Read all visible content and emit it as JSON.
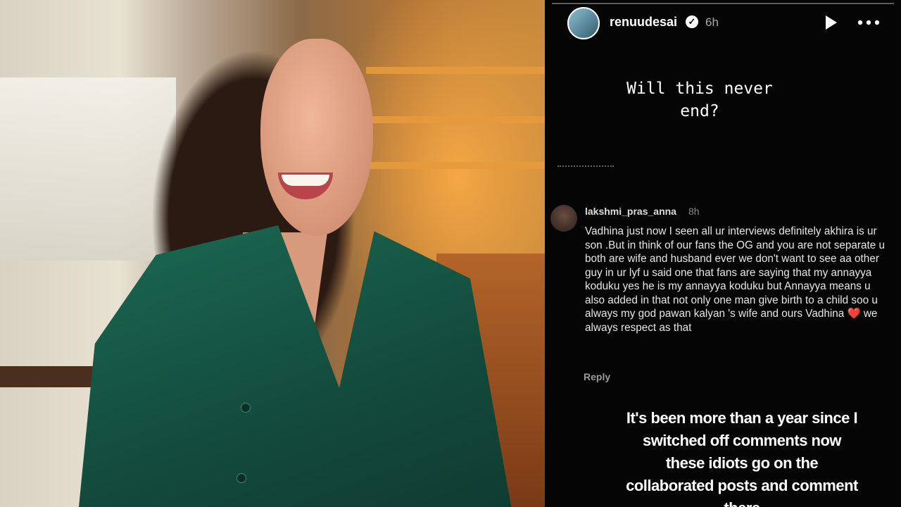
{
  "colors": {
    "story_background": "#050505",
    "shirt_green": "#174f3f",
    "heart": "#e0262d",
    "text_primary": "#ffffff",
    "text_muted": "#9a9a9a"
  },
  "photo": {
    "subject": "woman-in-green-shirt-smiling"
  },
  "story": {
    "header": {
      "username": "renuudesai",
      "verified_icon": "verified-badge-icon",
      "time_ago": "6h",
      "play_icon": "play-icon",
      "more_icon": "more-options-icon"
    },
    "question_text": "Will this never\nend?",
    "comment": {
      "username": "lakshmi_pras_anna",
      "time_ago": "8h",
      "body_before_heart": "Vadhina just now I seen all ur interviews definitely akhira is ur son .But in  think of our fans the OG and you are not separate u both are wife and husband ever we don't want to see aa other guy in ur lyf u said one that fans are saying that my annayya koduku yes he is my annayya koduku but Annayya means u also added in that not only one man give birth to a child soo u always my god pawan kalyan 's wife and ours Vadhina",
      "heart": "❤️",
      "body_after_heart": " we always respect as that",
      "reply_label": "Reply"
    },
    "caption": "It's been more than a year since I switched off comments now these idiots go on the collaborated posts and comment there"
  }
}
